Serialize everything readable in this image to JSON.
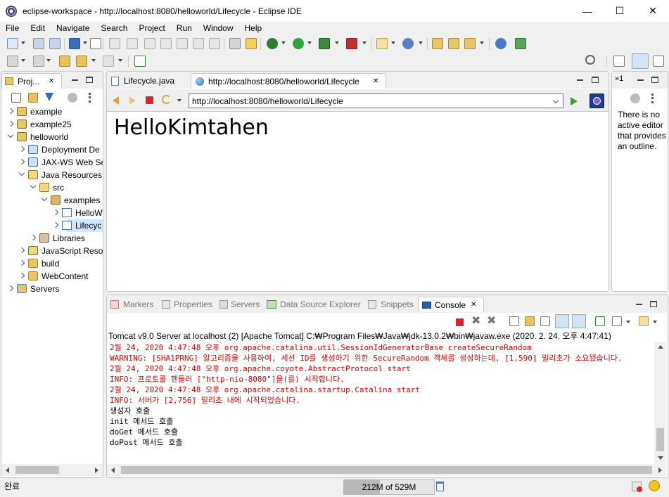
{
  "window": {
    "title": "eclipse-workspace - http://localhost:8080/helloworld/Lifecycle - Eclipse IDE",
    "minimize": "—",
    "maximize": "☐",
    "close": "✕"
  },
  "menu": [
    "File",
    "Edit",
    "Navigate",
    "Search",
    "Project",
    "Run",
    "Window",
    "Help"
  ],
  "project_explorer": {
    "tab_label": "Proj...",
    "tree": [
      {
        "label": "example",
        "level": 0,
        "state": "closed",
        "icon": "project-icon"
      },
      {
        "label": "example25",
        "level": 0,
        "state": "closed",
        "icon": "project-icon"
      },
      {
        "label": "helloworld",
        "level": 0,
        "state": "open",
        "icon": "project-icon"
      },
      {
        "label": "Deployment De",
        "level": 1,
        "state": "closed",
        "icon": "deployment-icon"
      },
      {
        "label": "JAX-WS Web Se",
        "level": 1,
        "state": "closed",
        "icon": "jaxws-icon"
      },
      {
        "label": "Java Resources",
        "level": 1,
        "state": "open",
        "icon": "java-resources-icon"
      },
      {
        "label": "src",
        "level": 2,
        "state": "open",
        "icon": "source-folder-icon"
      },
      {
        "label": "examples",
        "level": 3,
        "state": "open",
        "icon": "package-icon"
      },
      {
        "label": "HelloW",
        "level": 4,
        "state": "closed",
        "icon": "java-file-icon"
      },
      {
        "label": "Lifecyc",
        "level": 4,
        "state": "closed",
        "icon": "java-file-icon",
        "selected": true
      },
      {
        "label": "Libraries",
        "level": 2,
        "state": "closed",
        "icon": "libraries-icon"
      },
      {
        "label": "JavaScript Reso",
        "level": 1,
        "state": "closed",
        "icon": "javascript-icon"
      },
      {
        "label": "build",
        "level": 1,
        "state": "closed",
        "icon": "folder-icon"
      },
      {
        "label": "WebContent",
        "level": 1,
        "state": "closed",
        "icon": "folder-icon"
      },
      {
        "label": "Servers",
        "level": 0,
        "state": "closed",
        "icon": "servers-folder-icon"
      }
    ]
  },
  "editor": {
    "tabs": [
      {
        "label": "Lifecycle.java",
        "active": false
      },
      {
        "label": "http://localhost:8080/helloworld/Lifecycle",
        "active": true
      }
    ],
    "close_glyph": "✕",
    "url": "http://localhost:8080/helloworld/Lifecycle",
    "page_content": "HelloKimtahen"
  },
  "outline": {
    "tab_label": "»1",
    "message": "There is no active editor that provides an outline."
  },
  "bottom_tabs": [
    {
      "label": "Markers",
      "active": false
    },
    {
      "label": "Properties",
      "active": false
    },
    {
      "label": "Servers",
      "active": false
    },
    {
      "label": "Data Source Explorer",
      "active": false
    },
    {
      "label": "Snippets",
      "active": false
    },
    {
      "label": "Console",
      "active": true
    }
  ],
  "console": {
    "header": "Tomcat v9.0 Server at localhost (2) [Apache Tomcat] C:₩Program Files₩Java₩jdk-13.0.2₩bin₩javaw.exe (2020. 2. 24. 오후 4:47:41)",
    "lines": [
      {
        "text": "2월 24, 2020 4:47:48 오후 org.apache.catalina.util.SessionIdGeneratorBase createSecureRandom",
        "color": "#e00000"
      },
      {
        "text": "WARNING: [SHA1PRNG] 알고리즘을 사용하여, 세션 ID를 생성하기 위한 SecureRandom 객체를 생성하는데, [1,590] 밀리초가 소요됐습니다.",
        "color": "#e00000"
      },
      {
        "text": "2월 24, 2020 4:47:48 오후 org.apache.coyote.AbstractProtocol start",
        "color": "#e00000"
      },
      {
        "text": "INFO: 프로토콜 핸들러 [\"http-nio-8080\"]을(를) 시작합니다.",
        "color": "#e00000"
      },
      {
        "text": "2월 24, 2020 4:47:48 오후 org.apache.catalina.startup.Catalina start",
        "color": "#e00000"
      },
      {
        "text": "INFO: 서버가 [2,756] 밀리초 내에 시작되었습니다.",
        "color": "#e00000"
      },
      {
        "text": "생성자 호출",
        "color": "#000000"
      },
      {
        "text": "init 메서드 호출",
        "color": "#000000"
      },
      {
        "text": "doGet 메서드 호출",
        "color": "#000000"
      },
      {
        "text": "doPost 메서드 호출",
        "color": "#000000"
      }
    ]
  },
  "status_bar": {
    "left_text": "완료",
    "heap": "212M of 529M",
    "heap_fraction": 0.4
  },
  "colors": {
    "console_error": "#e00000",
    "selection": "#cde8ff",
    "run_green": "#2ea43a",
    "stop_red": "#d9262c"
  }
}
